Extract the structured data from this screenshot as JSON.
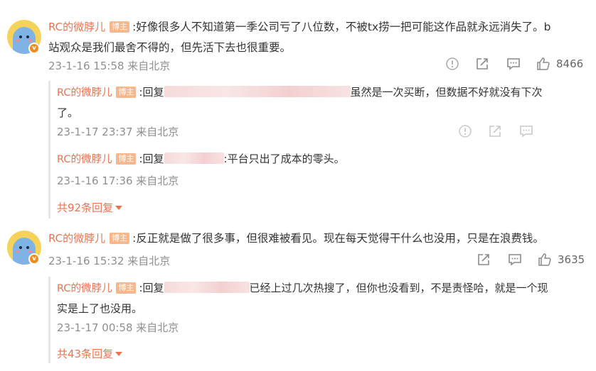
{
  "comments": [
    {
      "author": "RC的微脖儿",
      "badge": "博主",
      "text_line1": ":好像很多人不知道第一季公司亏了八位数，不被tx捞一把可能这作品就永远消失了。b",
      "text_line2": "站观众是我们最舍不得的，但先活下去也很重要。",
      "time": "23-1-16 15:58 来自北京",
      "like_count": "8466",
      "replies": [
        {
          "author": "RC的微脖儿",
          "badge": "博主",
          "prefix": ":回复",
          "text_line1_after": "虽然是一次买断，但数据不好就没有下次",
          "text_line2": "了。",
          "time": "23-1-17 23:37 来自北京"
        },
        {
          "author": "RC的微脖儿",
          "badge": "博主",
          "prefix": ":回复",
          "text_after": ":平台只出了成本的零头。",
          "time": "23-1-16 17:36 来自北京"
        }
      ],
      "more_replies": "共92条回复"
    },
    {
      "author": "RC的微脖儿",
      "badge": "博主",
      "text_line1": ":反正就是做了很多事，但很难被看见。现在每天觉得干什么也没用，只是在浪费钱。",
      "time": "23-1-16 15:32 来自北京",
      "like_count": "3635",
      "replies": [
        {
          "author": "RC的微脖儿",
          "badge": "博主",
          "prefix": ":回复",
          "text_line1_after": "已经上过几次热搜了，但你也没看到，不是责怪哈，就是一个现",
          "text_line2": "实是上了也没用。",
          "time": "23-1-17 00:58 来自北京"
        }
      ],
      "more_replies": "共43条回复"
    }
  ],
  "icons": {
    "report": "report-icon",
    "share": "share-icon",
    "comment": "comment-icon",
    "like": "like-icon"
  },
  "colors": {
    "author": "#eb7350",
    "badge": "#f7b78d",
    "time": "#8f8f8f",
    "text": "#333333"
  }
}
